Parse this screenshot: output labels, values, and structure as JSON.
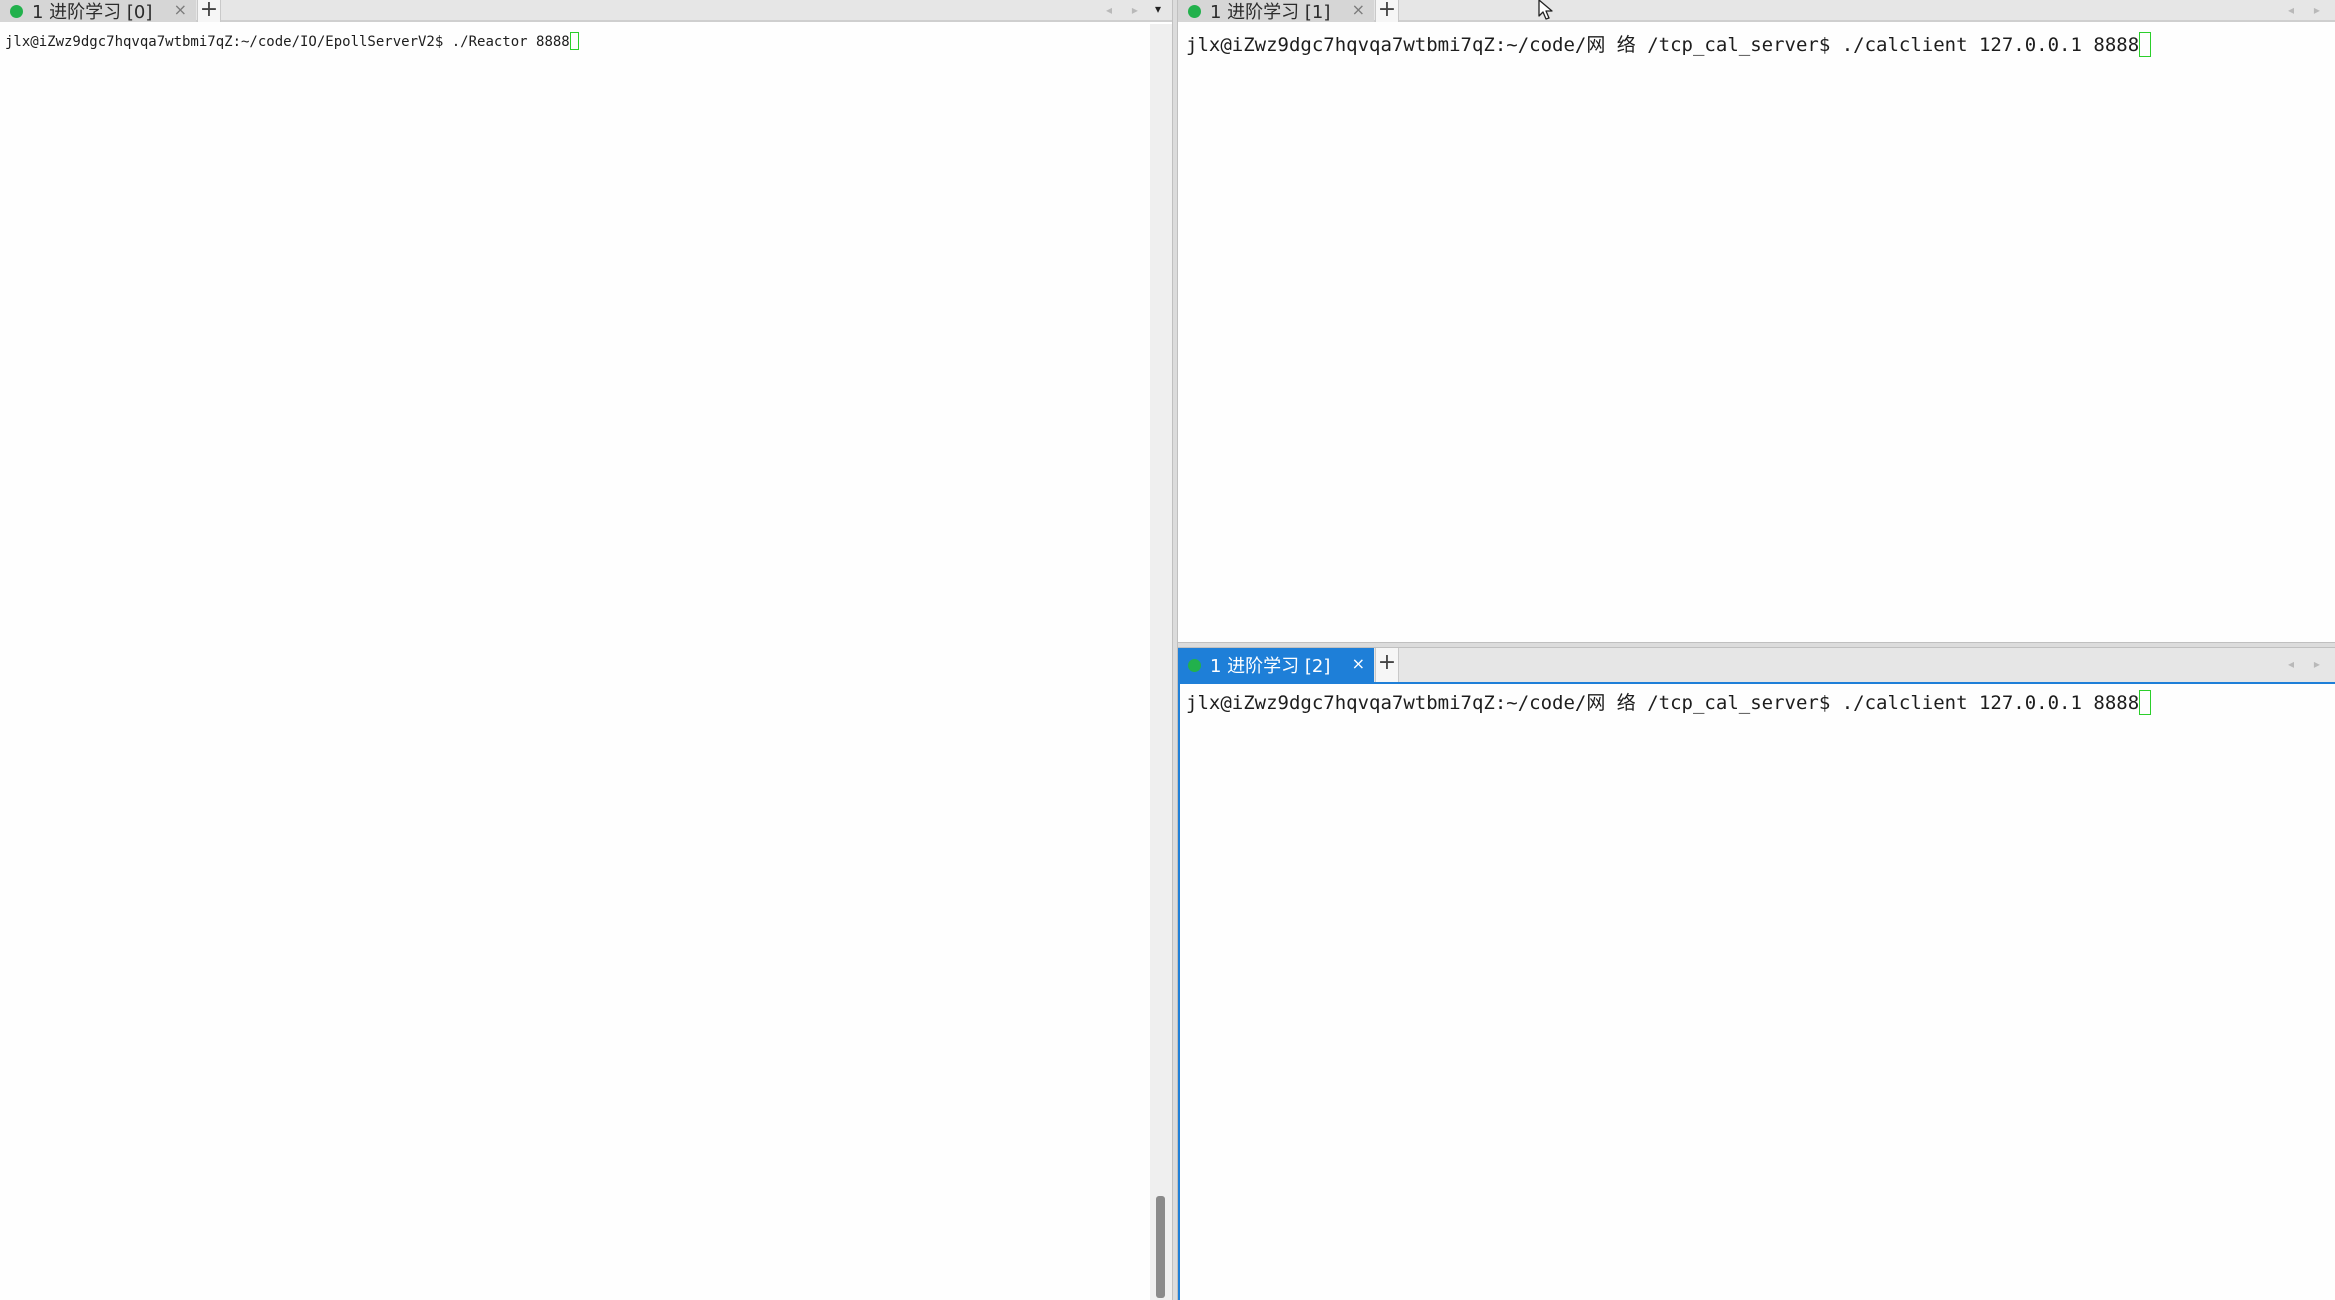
{
  "left_pane": {
    "tabs": [
      {
        "label": "1 进阶学习 [0]",
        "close": "×",
        "active": false,
        "status": "connected"
      }
    ],
    "new_tab": "+",
    "nav_arrows": "◂ ▸",
    "menu_arrow": "▾",
    "terminal": {
      "prompt": "jlx@iZwz9dgc7hqvqa7wtbmi7qZ:~/code/IO/EpollServerV2$ ",
      "command": "./Reactor 8888"
    },
    "scrollbar": {
      "position": 1.0
    }
  },
  "right_top_pane": {
    "tabs": [
      {
        "label": "1 进阶学习 [1]",
        "close": "×",
        "active": false,
        "status": "connected"
      }
    ],
    "new_tab": "+",
    "nav_arrows": "◂ ▸",
    "terminal": {
      "prompt": "jlx@iZwz9dgc7hqvqa7wtbmi7qZ:~/code/网 络 /tcp_cal_server$ ",
      "command": "./calclient 127.0.0.1 8888"
    }
  },
  "right_bottom_pane": {
    "tabs": [
      {
        "label": "1 进阶学习 [2]",
        "close": "×",
        "active": true,
        "status": "connected"
      }
    ],
    "new_tab": "+",
    "nav_arrows": "◂ ▸",
    "terminal": {
      "prompt": "jlx@iZwz9dgc7hqvqa7wtbmi7qZ:~/code/网 络 /tcp_cal_server$ ",
      "command": "./calclient 127.0.0.1 8888"
    }
  },
  "colors": {
    "active_tab": "#1e7fd8",
    "status_dot": "#22b14c",
    "cursor_outline": "#2bcf2b",
    "tabbar_bg": "#e6e6e6"
  }
}
